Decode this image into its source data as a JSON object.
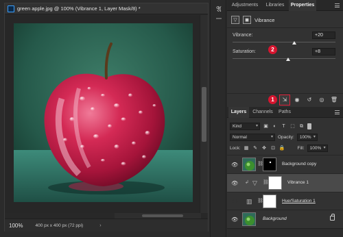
{
  "document": {
    "title": "green apple.jpg @ 100% (Vibrance 1, Layer Mask/8) *",
    "zoom": "100%",
    "dimensions": "400 px x 400 px (72 ppi)",
    "status_arrow": "›"
  },
  "tool_strip": {
    "character_icon": "𝔄"
  },
  "properties_tabs": [
    {
      "label": "Adjustments"
    },
    {
      "label": "Libraries"
    },
    {
      "label": "Properties"
    }
  ],
  "properties": {
    "title": "Vibrance",
    "sliders": [
      {
        "label": "Vibrance:",
        "value": "+20",
        "level": 0.6
      },
      {
        "label": "Saturation:",
        "value": "+8",
        "level": 0.54
      }
    ],
    "badges": [
      "1",
      "2"
    ]
  },
  "layers_tabs": [
    {
      "label": "Layers"
    },
    {
      "label": "Channels"
    },
    {
      "label": "Paths"
    }
  ],
  "layers_panel": {
    "filter": "Kind",
    "blend_mode": "Normal",
    "opacity_label": "Opacity:",
    "opacity": "100%",
    "lock_label": "Lock:",
    "fill_label": "Fill:",
    "fill": "100%",
    "layers": [
      {
        "name": "Background copy",
        "active": false
      },
      {
        "name": "Vibrance 1",
        "active": true
      },
      {
        "name": "Hue/Saturation 1",
        "active": false
      },
      {
        "name": "Background",
        "active": false
      }
    ]
  },
  "colors": {
    "accent_red": "#d7152f",
    "apple_red": "#c41c44",
    "background_teal": "#2f6b5a"
  }
}
